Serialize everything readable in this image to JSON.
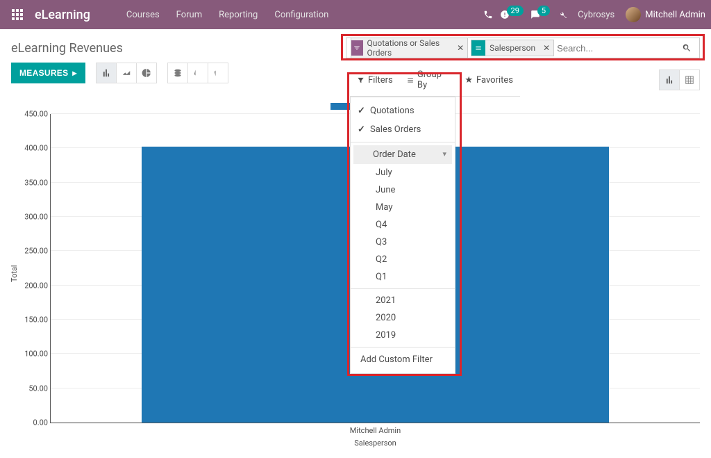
{
  "topbar": {
    "brand": "eLearning",
    "menu": [
      "Courses",
      "Forum",
      "Reporting",
      "Configuration"
    ],
    "badge_activities": "29",
    "badge_discuss": "5",
    "company": "Cybrosys",
    "user": "Mitchell Admin"
  },
  "control": {
    "title": "eLearning Revenues",
    "search": {
      "placeholder": "Search...",
      "facets": [
        {
          "type": "filter",
          "label": "Quotations or Sales Orders"
        },
        {
          "type": "group",
          "label": "Salesperson"
        }
      ]
    }
  },
  "toolbar": {
    "measures": "MEASURES"
  },
  "panel": {
    "tabs": {
      "filters": "Filters",
      "groupby": "Group By",
      "favorites": "Favorites"
    },
    "filters": {
      "items": [
        "Quotations",
        "Sales Orders"
      ],
      "date_label": "Order Date",
      "months": [
        "July",
        "June",
        "May"
      ],
      "quarters": [
        "Q4",
        "Q3",
        "Q2",
        "Q1"
      ],
      "years": [
        "2021",
        "2020",
        "2019"
      ],
      "custom": "Add Custom Filter"
    }
  },
  "chart_data": {
    "type": "bar",
    "categories": [
      "Mitchell Admin"
    ],
    "values": [
      402.5
    ],
    "tooltip": "402.50",
    "ylabel": "Total",
    "xlabel": "Salesperson",
    "ylim": [
      0,
      450
    ],
    "yticks": [
      0,
      50,
      100,
      150,
      200,
      250,
      300,
      350,
      400,
      450
    ],
    "ytick_labels": [
      "0.00",
      "50.00",
      "100.00",
      "150.00",
      "200.00",
      "250.00",
      "300.00",
      "350.00",
      "400.00",
      "450.00"
    ]
  }
}
